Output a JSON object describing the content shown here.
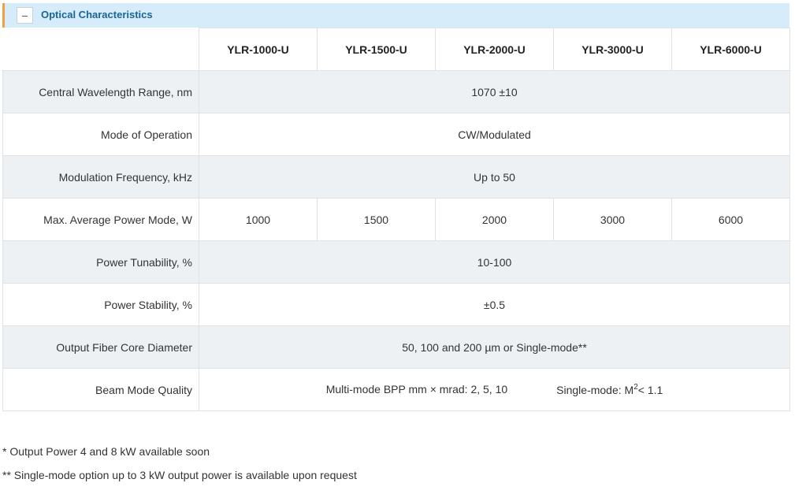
{
  "section": {
    "toggle_label": "–",
    "title": "Optical Characteristics"
  },
  "table": {
    "columns": [
      "YLR-1000-U",
      "YLR-1500-U",
      "YLR-2000-U",
      "YLR-3000-U",
      "YLR-6000-U"
    ],
    "rows": {
      "wavelength": {
        "label": "Central Wavelength Range, nm",
        "value": "1070 ±10"
      },
      "mode": {
        "label": "Mode of Operation",
        "value": "CW/Modulated"
      },
      "modulation": {
        "label": "Modulation Frequency, kHz",
        "value": "Up to 50"
      },
      "power": {
        "label": "Max. Average Power Mode, W",
        "values": [
          "1000",
          "1500",
          "2000",
          "3000",
          "6000"
        ]
      },
      "tunability": {
        "label": "Power Tunability, %",
        "value": "10-100"
      },
      "stability": {
        "label": "Power Stability, %",
        "value": "±0.5"
      },
      "fiber": {
        "label": "Output Fiber Core Diameter",
        "value": "50, 100 and 200 µm or Single-mode**"
      },
      "beam": {
        "label": "Beam Mode Quality",
        "multimode": "Multi-mode BPP mm × mrad: 2, 5, 10",
        "singlemode_prefix": "Single-mode: M",
        "singlemode_sup": "2",
        "singlemode_suffix": "< 1.1"
      }
    }
  },
  "notes": {
    "note1": "* Output Power 4 and 8 kW available soon",
    "note2": "** Single-mode option up to 3 kW output power is available upon request"
  }
}
